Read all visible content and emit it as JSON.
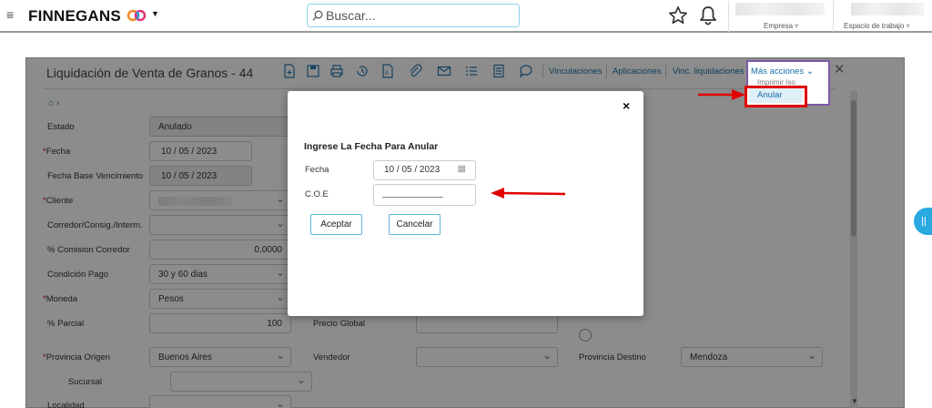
{
  "header": {
    "brand": "FINNEGANS",
    "search_placeholder": "Buscar...",
    "empresa_label": "Empresa",
    "espacio_label": "Espacio de trabajo"
  },
  "form": {
    "title": "Liquidación de Venta de Granos - 44",
    "toolbar_links": [
      "Vinculaciones",
      "Aplicaciones",
      "Vinc. liquidaciones"
    ],
    "more_actions": {
      "label": "Más acciones",
      "items": [
        "Imprimir Iso",
        "Anular"
      ]
    },
    "fields": {
      "estado": {
        "label": "Estado",
        "value": "Anulado"
      },
      "fecha": {
        "label": "Fecha",
        "value": "10 / 05 / 2023"
      },
      "fecha_base": {
        "label": "Fecha Base Vencimiento",
        "value": "10 / 05 / 2023"
      },
      "cliente": {
        "label": "Cliente",
        "value": ""
      },
      "corredor": {
        "label": "Corredor/Consig./Interm.",
        "value": ""
      },
      "comision": {
        "label": "% Comision Corredor",
        "value": "0.0000"
      },
      "condicion": {
        "label": "Condición Pago",
        "value": "30 y 60 dias"
      },
      "moneda": {
        "label": "Moneda",
        "value": "Pesos"
      },
      "parcial": {
        "label": "% Parcial",
        "value": "100"
      },
      "precio_global": {
        "label": "Precio Global",
        "value": ""
      },
      "provincia_origen": {
        "label": "Provincia Origen",
        "value": "Buenos Aires"
      },
      "vendedor": {
        "label": "Vendedor",
        "value": ""
      },
      "provincia_destino": {
        "label": "Provincia Destino",
        "value": "Mendoza"
      },
      "sucursal": {
        "label": "Sucursal",
        "value": ""
      },
      "localidad": {
        "label": "Localidad",
        "value": ""
      }
    }
  },
  "modal": {
    "title": "Ingrese La Fecha Para Anular",
    "fecha_label": "Fecha",
    "fecha_value": "10 / 05 / 2023",
    "coe_label": "C.O.E",
    "coe_value": "____________",
    "accept": "Aceptar",
    "cancel": "Cancelar",
    "close": "×"
  },
  "colors": {
    "accent": "#2aa9e0",
    "annotation": "#e00000",
    "link": "#1a6fa8"
  }
}
